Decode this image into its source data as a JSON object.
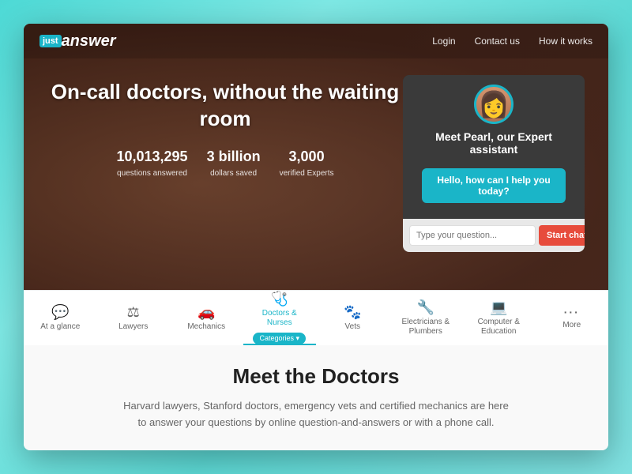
{
  "nav": {
    "logo_just": "just",
    "logo_answer": "answer",
    "links": [
      {
        "label": "Login",
        "id": "login"
      },
      {
        "label": "Contact us",
        "id": "contact"
      },
      {
        "label": "How it works",
        "id": "how-it-works"
      }
    ]
  },
  "hero": {
    "title": "On-call doctors, without the waiting room",
    "stats": [
      {
        "number": "10,013,295",
        "label": "questions answered"
      },
      {
        "number": "3 billion",
        "label": "dollars saved"
      },
      {
        "number": "3,000",
        "label": "verified Experts"
      }
    ]
  },
  "chat": {
    "title": "Meet Pearl, our Expert assistant",
    "bubble": "Hello, how can I help you today?",
    "input_placeholder": "Type your question...",
    "submit_label": "Start chat"
  },
  "categories": [
    {
      "id": "at-a-glance",
      "icon": "💬",
      "label": "At a glance",
      "active": false
    },
    {
      "id": "lawyers",
      "icon": "⚖",
      "label": "Lawyers",
      "active": false
    },
    {
      "id": "mechanics",
      "icon": "🚗",
      "label": "Mechanics",
      "active": false
    },
    {
      "id": "doctors-nurses",
      "icon": "🩺",
      "label": "Doctors &\nNurses",
      "active": true,
      "badge": "Categories ▾"
    },
    {
      "id": "vets",
      "icon": "🐾",
      "label": "Vets",
      "active": false
    },
    {
      "id": "electricians",
      "icon": "🔧",
      "label": "Electricians &\nPlumbers",
      "active": false
    },
    {
      "id": "computer-education",
      "icon": "💻",
      "label": "Computer &\nEducation",
      "active": false
    },
    {
      "id": "more",
      "icon": "···",
      "label": "More",
      "active": false
    }
  ],
  "section": {
    "title": "Meet the Doctors",
    "description": "Harvard lawyers, Stanford doctors, emergency vets and certified mechanics are here to answer your questions by online question-and-answers or with a phone call."
  },
  "colors": {
    "accent": "#1ab5c8",
    "danger": "#e74c3c"
  }
}
